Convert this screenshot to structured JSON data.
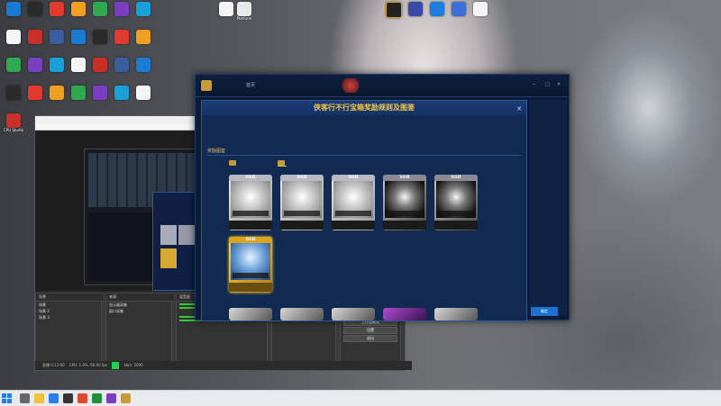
{
  "desktop": {
    "icons_left": [
      [
        "",
        "",
        "",
        "",
        "",
        "",
        ""
      ],
      [
        "",
        "",
        "",
        "",
        "",
        "",
        ""
      ],
      [
        "",
        "",
        "",
        "",
        "",
        "",
        ""
      ],
      [
        "",
        "",
        "",
        "",
        "",
        "",
        ""
      ],
      [
        "CPU Studio"
      ]
    ],
    "icon_colors": [
      "#1a7bd4",
      "#2a2a2a",
      "#e23b2e",
      "#f0a020",
      "#2fa84f",
      "#7a3fc0",
      "#1aa0d8",
      "#f4f4f4",
      "#c8302a",
      "#3a5fa0"
    ],
    "top_right_icons": [
      "Platform"
    ]
  },
  "obs": {
    "menu_items": "",
    "dock_headers": [
      "场景",
      "来源",
      "混音器",
      "",
      "控件"
    ],
    "scenes": [
      "场景",
      "场景 2",
      "场景 3"
    ],
    "sources": [
      "显示器采集",
      "窗口采集"
    ],
    "controls": [
      "开始直播",
      "开始录制",
      "工作室模式",
      "设置",
      "退出"
    ],
    "status": {
      "segments": [
        "直播 0:13:00",
        "CPU: 1.9%, 60.00 fps",
        "kb/s: 2000"
      ]
    }
  },
  "game": {
    "nav": [
      "首页",
      "",
      "",
      ""
    ],
    "window_controls": [
      "─",
      "□",
      "✕"
    ],
    "dialog": {
      "title": "侠客行不行宝箱奖励规则及图鉴",
      "close": "✕",
      "desc_lines": [
        "",
        "",
        ""
      ],
      "section_title": "奖励图鉴",
      "hint": "",
      "tabs": [
        "",
        ""
      ],
      "ssr_label": "SSR",
      "cards": [
        {
          "badge": "",
          "name": "",
          "style": "silver"
        },
        {
          "badge": "",
          "name": "",
          "style": "silver"
        },
        {
          "badge": "",
          "name": "",
          "style": "silver"
        },
        {
          "badge": "",
          "name": "",
          "style": "dark"
        },
        {
          "badge": "",
          "name": "",
          "style": "dark"
        },
        {
          "badge": "",
          "name": "",
          "style": "gold"
        }
      ]
    },
    "confirm_label": "确定"
  },
  "taskbar": {
    "clock_time": "",
    "clock_date": ""
  },
  "colors": {
    "gold_title": "#f3c64a",
    "dialog_bg": "#122a52",
    "live_green": "#1fd24b",
    "confirm_blue": "#1f6fd0"
  }
}
